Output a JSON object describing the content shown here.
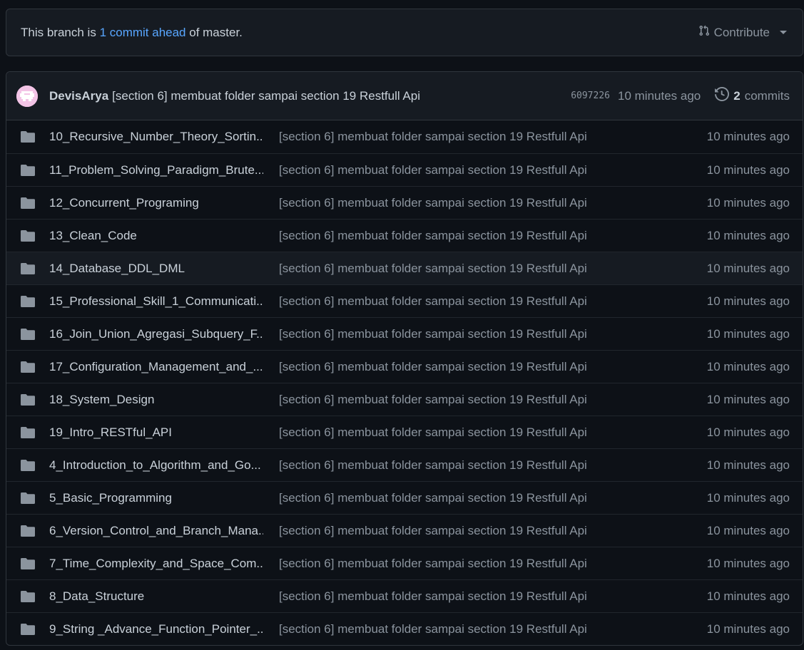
{
  "banner": {
    "prefix": "This branch is",
    "link": "1 commit ahead",
    "suffix": "of master.",
    "contribute_label": "Contribute"
  },
  "latest_commit": {
    "author": "DevisArya",
    "message": "[section 6] membuat folder sampai section 19 Restfull Api",
    "sha": "6097226",
    "age": "10 minutes ago",
    "commits_count": "2",
    "commits_word": "commits"
  },
  "files": [
    {
      "name": "10_Recursive_Number_Theory_Sortin...",
      "commit": "[section 6] membuat folder sampai section 19 Restfull Api",
      "age": "10 minutes ago"
    },
    {
      "name": "11_Problem_Solving_Paradigm_Brute...",
      "commit": "[section 6] membuat folder sampai section 19 Restfull Api",
      "age": "10 minutes ago"
    },
    {
      "name": "12_Concurrent_Programing",
      "commit": "[section 6] membuat folder sampai section 19 Restfull Api",
      "age": "10 minutes ago"
    },
    {
      "name": "13_Clean_Code",
      "commit": "[section 6] membuat folder sampai section 19 Restfull Api",
      "age": "10 minutes ago"
    },
    {
      "name": "14_Database_DDL_DML",
      "commit": "[section 6] membuat folder sampai section 19 Restfull Api",
      "age": "10 minutes ago"
    },
    {
      "name": "15_Professional_Skill_1_Communicati...",
      "commit": "[section 6] membuat folder sampai section 19 Restfull Api",
      "age": "10 minutes ago"
    },
    {
      "name": "16_Join_Union_Agregasi_Subquery_F...",
      "commit": "[section 6] membuat folder sampai section 19 Restfull Api",
      "age": "10 minutes ago"
    },
    {
      "name": "17_Configuration_Management_and_...",
      "commit": "[section 6] membuat folder sampai section 19 Restfull Api",
      "age": "10 minutes ago"
    },
    {
      "name": "18_System_Design",
      "commit": "[section 6] membuat folder sampai section 19 Restfull Api",
      "age": "10 minutes ago"
    },
    {
      "name": "19_Intro_RESTful_API",
      "commit": "[section 6] membuat folder sampai section 19 Restfull Api",
      "age": "10 minutes ago"
    },
    {
      "name": "4_Introduction_to_Algorithm_and_Go...",
      "commit": "[section 6] membuat folder sampai section 19 Restfull Api",
      "age": "10 minutes ago"
    },
    {
      "name": "5_Basic_Programming",
      "commit": "[section 6] membuat folder sampai section 19 Restfull Api",
      "age": "10 minutes ago"
    },
    {
      "name": "6_Version_Control_and_Branch_Mana...",
      "commit": "[section 6] membuat folder sampai section 19 Restfull Api",
      "age": "10 minutes ago"
    },
    {
      "name": "7_Time_Complexity_and_Space_Com...",
      "commit": "[section 6] membuat folder sampai section 19 Restfull Api",
      "age": "10 minutes ago"
    },
    {
      "name": "8_Data_Structure",
      "commit": "[section 6] membuat folder sampai section 19 Restfull Api",
      "age": "10 minutes ago"
    },
    {
      "name": "9_String _Advance_Function_Pointer_...",
      "commit": "[section 6] membuat folder sampai section 19 Restfull Api",
      "age": "10 minutes ago"
    }
  ],
  "hovered_row": 4,
  "icons": {
    "contribute": "git-pull-request-icon",
    "history": "history-icon",
    "folder": "folder-icon",
    "avatar": "identicon-avatar"
  },
  "colors": {
    "background": "#0d1117",
    "panel": "#161b22",
    "border": "#30363d",
    "link": "#58a6ff",
    "text": "#c9d1d9",
    "muted": "#8b949e",
    "avatar_bg": "#f3c4e6"
  }
}
